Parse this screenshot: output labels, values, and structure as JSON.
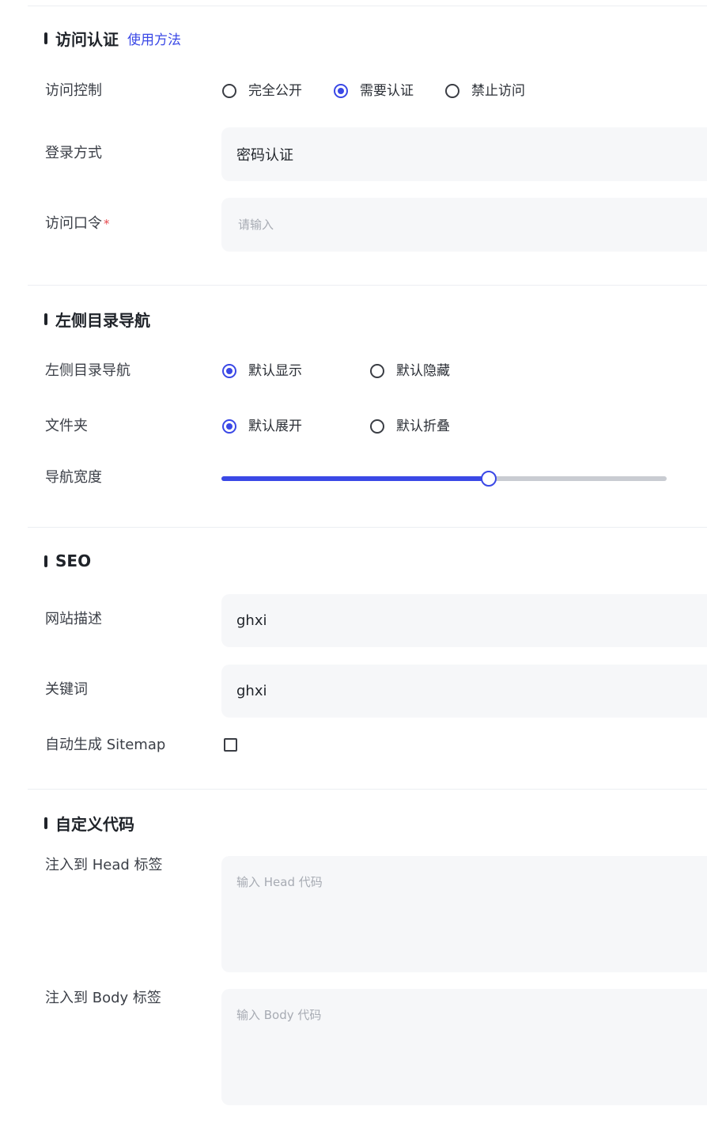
{
  "access_auth": {
    "title": "访问认证",
    "help_link": "使用方法",
    "access_control": {
      "label": "访问控制",
      "options": [
        {
          "label": "完全公开",
          "selected": false
        },
        {
          "label": "需要认证",
          "selected": true
        },
        {
          "label": "禁止访问",
          "selected": false
        }
      ]
    },
    "login_method": {
      "label": "登录方式",
      "value": "密码认证"
    },
    "passcode": {
      "label": "访问口令",
      "required_mark": "*",
      "placeholder": "请输入"
    }
  },
  "left_nav": {
    "title": "左侧目录导航",
    "nav_display": {
      "label": "左侧目录导航",
      "options": [
        {
          "label": "默认显示",
          "selected": true
        },
        {
          "label": "默认隐藏",
          "selected": false
        }
      ]
    },
    "folder": {
      "label": "文件夹",
      "options": [
        {
          "label": "默认展开",
          "selected": true
        },
        {
          "label": "默认折叠",
          "selected": false
        }
      ]
    },
    "nav_width": {
      "label": "导航宽度",
      "fraction": 0.6
    }
  },
  "seo": {
    "title": "SEO",
    "site_description": {
      "label": "网站描述",
      "value": "ghxi"
    },
    "keywords": {
      "label": "关键词",
      "value": "ghxi"
    },
    "sitemap": {
      "label": "自动生成 Sitemap",
      "checked": false
    }
  },
  "custom_code": {
    "title": "自定义代码",
    "head": {
      "label": "注入到 Head 标签",
      "placeholder": "输入 Head 代码"
    },
    "body": {
      "label": "注入到 Body 标签",
      "placeholder": "输入 Body 代码"
    }
  },
  "colors": {
    "accent": "#3a48e6",
    "field_bg": "#f6f7f9",
    "required": "#e5484d"
  }
}
